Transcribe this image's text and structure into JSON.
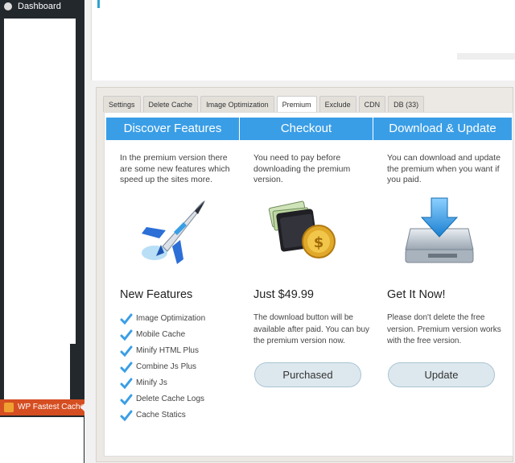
{
  "sidebar": {
    "dashboard_label": "Dashboard",
    "plugin_label": "WP Fastest Cache"
  },
  "tabs": [
    "Settings",
    "Delete Cache",
    "Image Optimization",
    "Premium",
    "Exclude",
    "CDN",
    "DB (33)"
  ],
  "active_tab": "Premium",
  "columns": {
    "features": {
      "header": "Discover Features",
      "description": "In the premium version there are some new features which speed up the sites more.",
      "title": "New Features",
      "items": [
        "Image Optimization",
        "Mobile Cache",
        "Minify HTML Plus",
        "Combine Js Plus",
        "Minify Js",
        "Delete Cache Logs",
        "Cache Statics"
      ]
    },
    "checkout": {
      "header": "Checkout",
      "description": "You need to pay before downloading the premium version.",
      "title": "Just $49.99",
      "note": "The download button will be available after paid. You can buy the premium version now.",
      "button": "Purchased"
    },
    "download": {
      "header": "Download & Update",
      "description": "You can download and update the premium when you want if you paid.",
      "title": "Get It Now!",
      "note": "Please don't delete the free version. Premium version works with the free version.",
      "button": "Update"
    }
  },
  "colors": {
    "header_blue": "#3a9ee6",
    "check_blue": "#3a9ee6",
    "sidebar_dark": "#23282d",
    "plugin_highlight": "#d54e21"
  }
}
